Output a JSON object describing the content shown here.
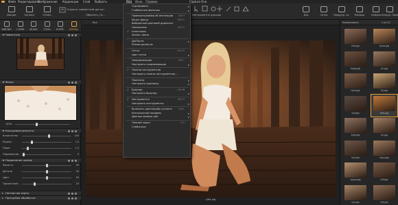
{
  "menubar": {
    "items": [
      "Файл",
      "Редактировать",
      "Изображение",
      "Коррекции",
      "Слой",
      "Выбрать",
      "Вид",
      "Окно",
      "Справка"
    ],
    "active_index": 6,
    "right_title": "Capture One"
  },
  "toolbar": {
    "left_buttons": [
      {
        "label": "Импорт",
        "icon": "import-icon"
      },
      {
        "label": "Экспорт",
        "icon": "export-icon"
      },
      {
        "label": "Отмен.",
        "icon": "undo-icon"
      }
    ],
    "session_text": "Открыть совместный доступ",
    "cursor_group": "Обрезать, Ос...",
    "cursor_tools_label": "Инструменты курсора",
    "right_buttons": [
      {
        "label": "Дзи",
        "icon": "grid-icon"
      },
      {
        "label": "Сетка",
        "icon": "raster-icon"
      },
      {
        "label": "Предупр. из зап.",
        "icon": "warning-icon"
      },
      {
        "label": "Помощь",
        "icon": "help-icon"
      },
      {
        "label": "Камера",
        "icon": "camera-icon"
      },
      {
        "label": "Конкур. Правила",
        "icon": "rules-icon"
      }
    ]
  },
  "tool_tabs": [
    {
      "label": "БИБЛИО.",
      "icon": "library-icon"
    },
    {
      "label": "С.ЕНИЕ",
      "icon": "capture-icon"
    },
    {
      "label": "ОБЪЕК.",
      "icon": "lens-icon"
    },
    {
      "label": "СТАТЬ",
      "icon": "color-icon"
    },
    {
      "label": "КОРРЕ.",
      "icon": "exposure-icon"
    },
    {
      "label": "УЛУЧШ.",
      "icon": "details-icon"
    }
  ],
  "left_panel": {
    "navigator_title": "Навигатор",
    "focus_title": "Фокус",
    "zoom_value": "100%",
    "clarity_title": "Кольцевые резкости",
    "clarity_sliders": [
      {
        "label": "Количество",
        "value": "140",
        "pct": 0.55
      },
      {
        "label": "Радиус",
        "value": "1,0",
        "pct": 0.2
      },
      {
        "label": "Порог",
        "value": "1,0",
        "pct": 0.12
      },
      {
        "label": "Подавление…",
        "value": "0",
        "pct": 0.03
      }
    ],
    "noise_title": "Подавление шумов",
    "noise_sliders": [
      {
        "label": "Яркость",
        "value": "50",
        "pct": 0.5
      },
      {
        "label": "Детали",
        "value": "50",
        "pct": 0.5
      },
      {
        "label": "Цвет",
        "value": "50",
        "pct": 0.5
      },
      {
        "label": "Одиночный…",
        "value": "25",
        "pct": 0.25
      }
    ],
    "sections_below": [
      "Пятнистая зерно",
      "Пригрубая обработки"
    ]
  },
  "viewer": {
    "header_text": "Все",
    "caption": "lytia.jpg"
  },
  "browser": {
    "count_text": "1 из 22",
    "view_label": "Компоновать",
    "thumbnails": [
      {
        "name": "tito.jpg",
        "color": "#8a6a58"
      },
      {
        "name": "tyuro.jpg",
        "color": "#b8855a"
      },
      {
        "name": "tyjog.jpg",
        "color": "#6a5040"
      },
      {
        "name": "tyi.jpg",
        "color": "#9a7a62"
      },
      {
        "name": "tytis.jpg",
        "color": "#7d604c"
      },
      {
        "name": "fyj.jpg",
        "color": "#c8a574"
      },
      {
        "name": "tyrsjpg",
        "color": "#5a4a42"
      },
      {
        "name": "lytia.jpg",
        "color": "#c07a3c",
        "selected": true
      },
      {
        "name": "tyijo.jpg",
        "color": "#8e7260"
      },
      {
        "name": "tyl.jpg",
        "color": "#a48066"
      },
      {
        "name": "tyti.jpg",
        "color": "#6e5648"
      },
      {
        "name": "tygu.jpg",
        "color": "#9c7a5e"
      },
      {
        "name": "tyguo.jpg",
        "color": "#b59070"
      },
      {
        "name": "tylf.jpg",
        "color": "#7a5c48"
      },
      {
        "name": "typ.jpg",
        "color": "#a88668"
      },
      {
        "name": "tyk.jpg",
        "color": "#8c6c56"
      }
    ]
  },
  "view_menu": {
    "items": [
      {
        "text": "Сортировать",
        "sub": true
      },
      {
        "text": "Глобальные фильтры",
        "sub": true
      },
      {
        "sep": true
      },
      {
        "text": "Проверять/выбор об инспекции",
        "sc": "Ctrl+I"
      },
      {
        "text": "Мульт-фокус",
        "sc": "Ctrl+T"
      },
      {
        "text": "Выбранный цветовой диапазон"
      },
      {
        "text": "Наложение",
        "sc": "Ctrl+Y"
      },
      {
        "text": "Аннотации",
        "check": true
      },
      {
        "text": "Захват цвета"
      },
      {
        "sep": true
      },
      {
        "text": "До/После",
        "sub": true
      },
      {
        "text": "Режим до/после"
      },
      {
        "sep": true
      },
      {
        "text": "Сетка",
        "sc": "Ctrl+G"
      },
      {
        "text": "Цвет сетки",
        "sub": true
      },
      {
        "sep": true
      },
      {
        "text": "Направляющие",
        "sc": "Ctrl+;"
      },
      {
        "text": "Настроить направляющие",
        "sub": true
      },
      {
        "sep": true
      },
      {
        "text": "Панели инструментов",
        "check": true
      },
      {
        "text": "Настроить панель инструментов…"
      },
      {
        "sep": true
      },
      {
        "text": "Просмотр",
        "sub": true
      },
      {
        "text": "Настроить просмотр",
        "sub": true
      },
      {
        "sep": true
      },
      {
        "text": "Браузер",
        "sc": "Ctrl+B",
        "check": true
      },
      {
        "text": "Настроить браузер",
        "sub": true
      },
      {
        "sep": true
      },
      {
        "text": "Инструменты",
        "sc": "Ctrl+T",
        "check": true
      },
      {
        "text": "Настроить инструменты",
        "sub": true
      },
      {
        "sep": true
      },
      {
        "text": "Включить цветопробу усилити",
        "sc": "Ctrl+"
      },
      {
        "text": "Контрольный профиль",
        "sub": true
      },
      {
        "text": "Данные камеры (all)",
        "sub": true
      },
      {
        "sep": true
      },
      {
        "text": "Полный экран",
        "sc": "F11"
      },
      {
        "text": "Слайд-шоу"
      }
    ]
  },
  "colors": {
    "accent": "#e8a33d",
    "panel": "#262626",
    "menu_bg": "#2c2c2c"
  }
}
